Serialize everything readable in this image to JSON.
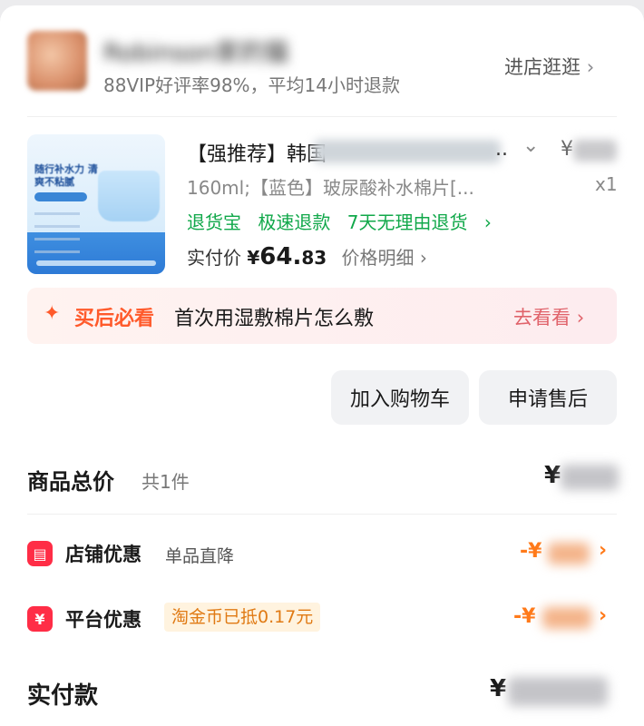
{
  "store": {
    "name": "Robinson家的猫",
    "stats": "88VIP好评率98%，平均14小时退款",
    "visit_label": "进店逛逛",
    "chevron": "›"
  },
  "product": {
    "title_prefix": "【强推荐】韩国",
    "title_ellipsis": "..",
    "price_symbol": "¥",
    "spec": "160ml;【蓝色】玻尿酸补水棉片[...",
    "quantity": "x1",
    "services": [
      "退货宝",
      "极速退款",
      "7天无理由退货"
    ],
    "services_chevron": "›",
    "paid_label": "实付价",
    "paid_currency": "¥",
    "paid_integer": "64.",
    "paid_decimal": "83",
    "price_detail_label": "价格明细",
    "thumb_title": "随行补水力 清爽不粘腻"
  },
  "tip": {
    "icon": "✦",
    "strong": "买后必看",
    "text": "首次用湿敷棉片怎么敷",
    "link": "去看看",
    "chevron": "›"
  },
  "actions": {
    "add_to_cart": "加入购物车",
    "after_sales": "申请售后"
  },
  "summary": {
    "total_label": "商品总价",
    "total_count": "共1件",
    "total_currency": "¥",
    "shop_discount_label": "店铺优惠",
    "shop_discount_sub": "单品直降",
    "shop_discount_prefix": "-¥",
    "platform_discount_label": "平台优惠",
    "platform_discount_tag": "淘金币已抵0.17元",
    "platform_discount_prefix": "-¥",
    "pay_label": "实付款",
    "pay_currency": "¥",
    "chevron": "›",
    "shop_icon_glyph": "▤",
    "platform_icon_glyph": "¥"
  },
  "colors": {
    "accent_red": "#ff2d46",
    "discount_orange": "#ff7a1a",
    "service_green": "#11a84a",
    "tip_orange": "#ff5a2b"
  }
}
